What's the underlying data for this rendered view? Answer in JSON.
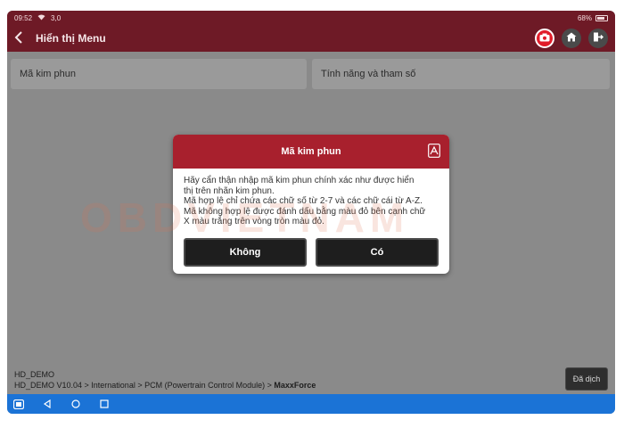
{
  "status": {
    "time": "09:52",
    "network": "3,0",
    "battery": "68%"
  },
  "header": {
    "title": "Hiển thị Menu"
  },
  "tiles": {
    "left": "Mã kim phun",
    "right": "Tính năng và tham số"
  },
  "dialog": {
    "title": "Mã kim phun",
    "lines": [
      "Hãy cẩn thận nhập mã kim phun chính xác như được hiển",
      "thị trên nhãn kim phun.",
      "Mã hợp lệ chỉ chứa các chữ số từ 2-7 và các chữ cái từ A-Z.",
      "Mã không hợp lệ được đánh dấu bằng màu đỏ bên cạnh chữ",
      "X màu trắng trên vòng tròn màu đỏ."
    ],
    "no_label": "Không",
    "yes_label": "Có"
  },
  "footer": {
    "line1": "HD_DEMO",
    "path_prefix": "HD_DEMO V10.04 > International > PCM (Powertrain Control Module) > ",
    "path_last": "MaxxForce",
    "translated_label": "Đã dịch"
  },
  "watermark": "OBDVIETNAM",
  "colors": {
    "header_bg": "#6e1a26",
    "dialog_header": "#a8202d",
    "camera_button": "#e11d2a",
    "navbar": "#1b73d6"
  },
  "icons": {
    "back": "chevron-left-icon",
    "camera": "camera-icon",
    "home": "home-icon",
    "exit": "exit-icon",
    "dialog_header": "info-card-icon"
  }
}
